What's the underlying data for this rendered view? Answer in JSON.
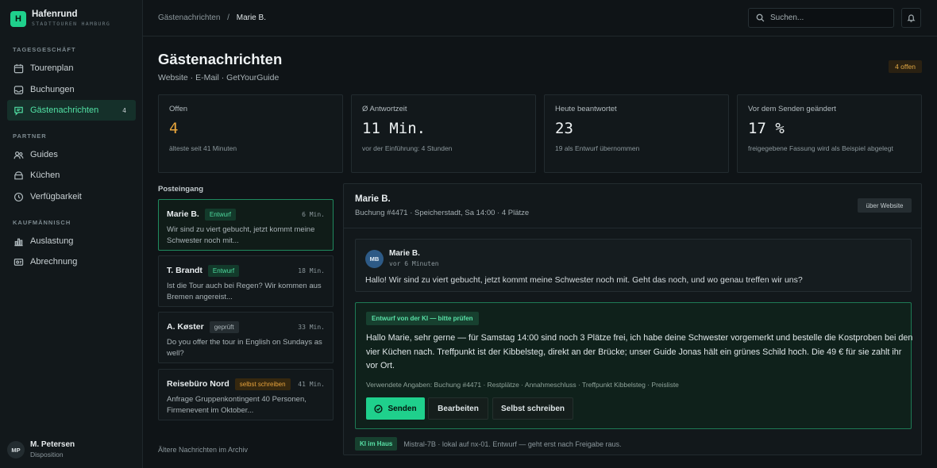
{
  "brand": {
    "logo_letter": "H",
    "name": "Hafenrund",
    "subtitle": "STADTTOUREN HAMBURG"
  },
  "sidebar": {
    "sections": [
      {
        "label": "TAGESGESCHÄFT"
      },
      {
        "label": "PARTNER"
      },
      {
        "label": "KAUFMÄNNISCH"
      }
    ],
    "items": [
      {
        "label": "Tourenplan",
        "icon": "calendar-icon"
      },
      {
        "label": "Buchungen",
        "icon": "inbox-icon"
      },
      {
        "label": "Gästenachrichten",
        "icon": "chat-icon",
        "count": "4",
        "active": true
      },
      {
        "label": "Guides",
        "icon": "users-icon"
      },
      {
        "label": "Küchen",
        "icon": "kitchen-icon"
      },
      {
        "label": "Verfügbarkeit",
        "icon": "clock-icon"
      },
      {
        "label": "Auslastung",
        "icon": "bar-chart-icon"
      },
      {
        "label": "Abrechnung",
        "icon": "billing-icon"
      }
    ],
    "user": {
      "initials": "MP",
      "name": "M. Petersen",
      "role": "Disposition"
    }
  },
  "topbar": {
    "breadcrumb": [
      "Gästenachrichten",
      "Marie B."
    ],
    "breadcrumb_sep": "/",
    "search_placeholder": "Suchen..."
  },
  "header": {
    "title": "Gästenachrichten",
    "subtitle": "Website · E-Mail · GetYourGuide",
    "open_badge": "4 offen"
  },
  "stats": [
    {
      "label": "Offen",
      "value": "4",
      "note": "älteste seit 41 Minuten",
      "accent": "#e8a53c"
    },
    {
      "label": "Ø Antwortzeit",
      "value": "11 Min.",
      "note": "vor der Einführung: 4 Stunden"
    },
    {
      "label": "Heute beantwortet",
      "value": "23",
      "note": "19 als Entwurf übernommen"
    },
    {
      "label": "Vor dem Senden geändert",
      "value": "17 %",
      "note": "freigegebene Fassung wird als Beispiel abgelegt"
    }
  ],
  "inbox": {
    "title": "Posteingang",
    "items": [
      {
        "name": "Marie B.",
        "tag": "Entwurf",
        "tag_style": "green",
        "time": "6 Min.",
        "snippet": "Wir sind zu viert gebucht, jetzt kommt meine Schwester noch mit...",
        "selected": true
      },
      {
        "name": "T. Brandt",
        "tag": "Entwurf",
        "tag_style": "green",
        "time": "18 Min.",
        "snippet": "Ist die Tour auch bei Regen? Wir kommen aus Bremen angereist..."
      },
      {
        "name": "A. Køster",
        "tag": "geprüft",
        "tag_style": "grey",
        "time": "33 Min.",
        "snippet": "Do you offer the tour in English on Sundays as well?"
      },
      {
        "name": "Reisebüro Nord",
        "tag": "selbst schreiben",
        "tag_style": "amber",
        "time": "41 Min.",
        "snippet": "Anfrage Gruppenkontingent 40 Personen, Firmenevent im Oktober..."
      }
    ],
    "archive_link": "Ältere Nachrichten im Archiv"
  },
  "detail": {
    "name": "Marie B.",
    "meta": "Buchung #4471 · Speicherstadt, Sa 14:00 · 4 Plätze",
    "via": "über Website",
    "message": {
      "initials": "MB",
      "sender": "Marie B.",
      "time": "vor 6 Minuten",
      "text": "Hallo! Wir sind zu viert gebucht, jetzt kommt meine Schwester noch mit. Geht das noch, und wo genau treffen wir uns?"
    },
    "draft": {
      "label": "Entwurf von der KI — bitte prüfen",
      "text": "Hallo Marie, sehr gerne — für Samstag 14:00 sind noch 3 Plätze frei, ich habe deine Schwester vorgemerkt und bestelle die Kostproben bei den vier Küchen nach. Treffpunkt ist der Kibbelsteg, direkt an der Brücke; unser Guide Jonas hält ein grünes Schild hoch. Die 49 € für sie zahlt ihr vor Ort.",
      "sources": "Verwendete Angaben: Buchung #4471 · Restplätze · Annahmeschluss · Treffpunkt Kibbelsteg · Preisliste",
      "send_label": "Senden",
      "edit_label": "Bearbeiten",
      "self_label": "Selbst schreiben"
    },
    "footer": {
      "badge": "KI im Haus",
      "text": "Mistral-7B · lokal auf nx-01. Entwurf — geht erst nach Freigabe raus."
    }
  },
  "colors": {
    "accent": "#1fd08c",
    "warning": "#e8a53c",
    "background": "#0f1417"
  }
}
